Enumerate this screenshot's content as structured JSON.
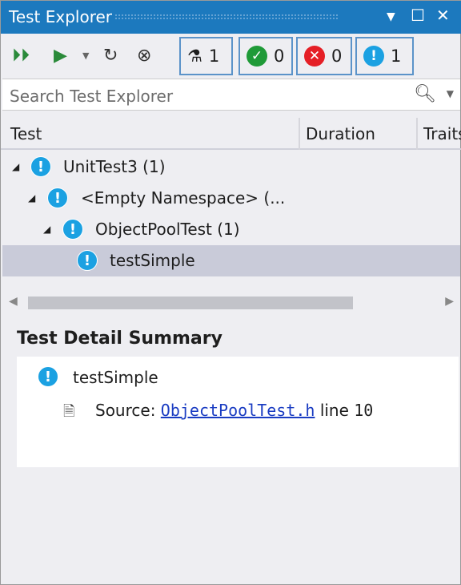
{
  "title": "Test Explorer",
  "toolbar": {
    "counts": [
      {
        "icon": "flask-icon",
        "value": "1"
      },
      {
        "icon": "passed-icon",
        "value": "0",
        "color": "#1f9a38"
      },
      {
        "icon": "failed-icon",
        "value": "0",
        "color": "#e51f26"
      },
      {
        "icon": "not-run-icon",
        "value": "1",
        "color": "#1ba1e2"
      }
    ]
  },
  "search": {
    "placeholder": "Search Test Explorer"
  },
  "columns": [
    "Test",
    "Duration",
    "Traits"
  ],
  "tree": [
    {
      "label": "UnitTest3  (1)"
    },
    {
      "label": "<Empty Namespace>  (..."
    },
    {
      "label": "ObjectPoolTest  (1)"
    },
    {
      "label": "testSimple",
      "selected": true
    }
  ],
  "detail": {
    "heading": "Test Detail Summary",
    "test": "testSimple",
    "source_label": "Source:",
    "source_file": "ObjectPoolTest.h",
    "line_label": "line",
    "line": "10"
  }
}
